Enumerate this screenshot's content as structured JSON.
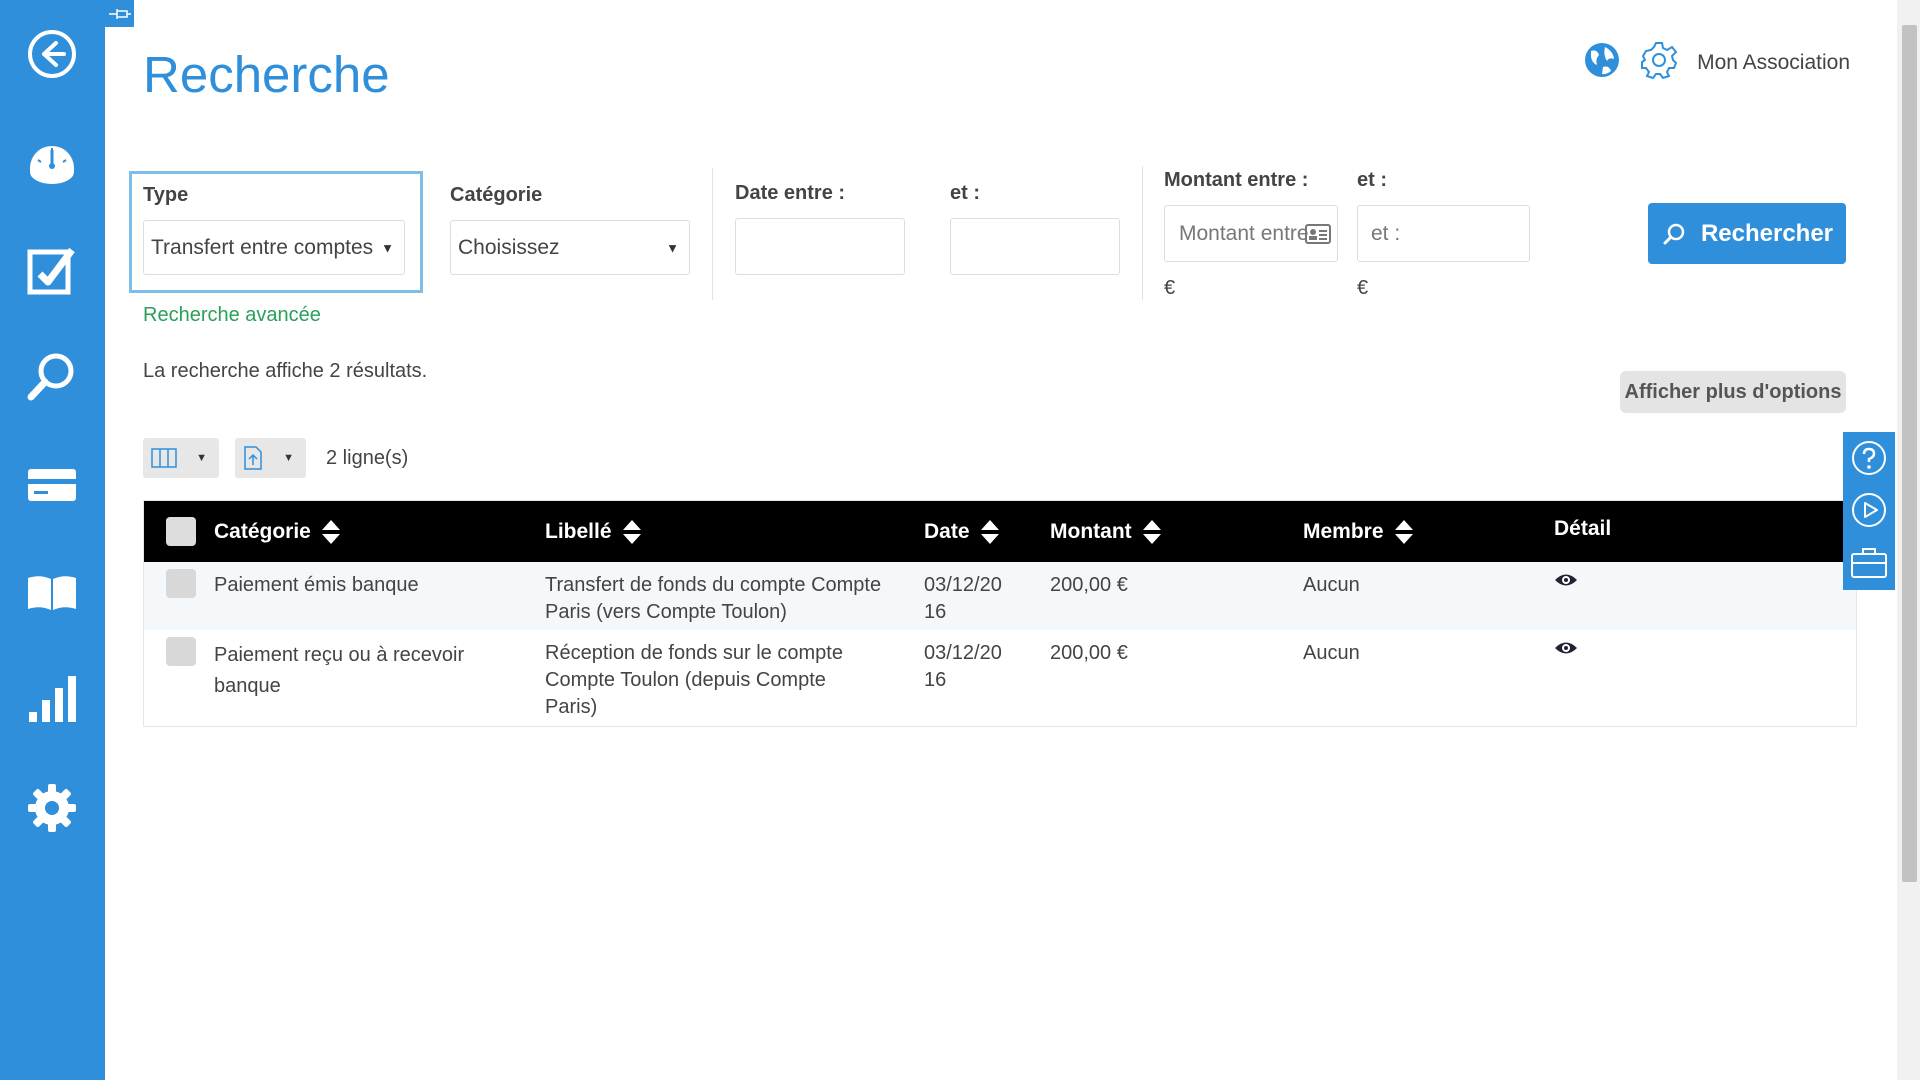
{
  "page": {
    "title": "Recherche"
  },
  "header": {
    "association": "Mon Association"
  },
  "filters": {
    "type_label": "Type",
    "type_value": "Transfert entre comptes",
    "category_label": "Catégorie",
    "category_value": "Choisissez",
    "date_from_label": "Date entre :",
    "date_to_label": "et :",
    "amount_from_label": "Montant entre :",
    "amount_from_placeholder": "Montant entre :",
    "amount_to_label": "et :",
    "amount_to_placeholder": "et :",
    "currency": "€",
    "advanced_link": "Recherche avancée",
    "search_button": "Rechercher"
  },
  "results": {
    "summary": "La recherche affiche 2 résultats.",
    "more_options": "Afficher plus d'options",
    "row_count": "2 ligne(s)"
  },
  "table": {
    "headers": {
      "category": "Catégorie",
      "label": "Libellé",
      "date": "Date",
      "amount": "Montant",
      "member": "Membre",
      "detail": "Détail"
    },
    "rows": [
      {
        "category": "Paiement émis banque",
        "label": "Transfert de fonds du compte Compte Paris (vers Compte Toulon)",
        "date": "03/12/2016",
        "amount": "200,00 €",
        "member": "Aucun"
      },
      {
        "category": "Paiement reçu ou à recevoir banque",
        "label": "Réception de fonds sur le compte Compte Toulon (depuis Compte Paris)",
        "date": "03/12/2016",
        "amount": "200,00 €",
        "member": "Aucun"
      }
    ]
  },
  "colors": {
    "primary": "#2f8fdb",
    "link_green": "#2aa05a",
    "header_black": "#000000"
  }
}
